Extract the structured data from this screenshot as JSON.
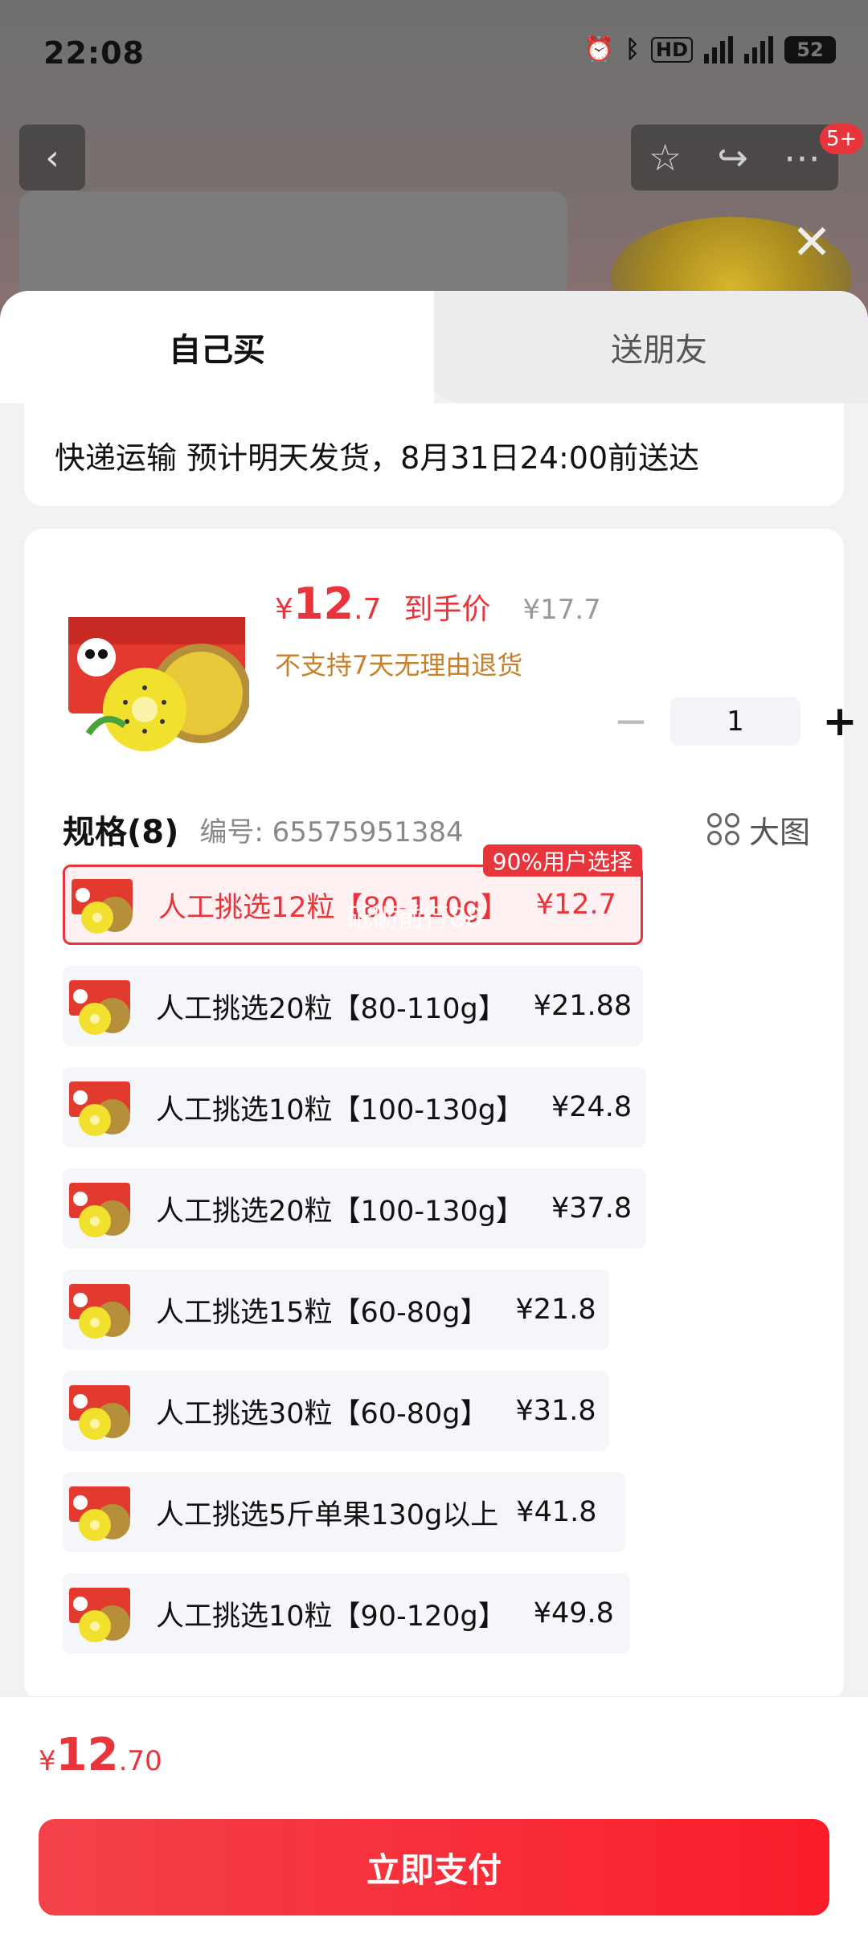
{
  "status_bar": {
    "time": "22:08",
    "battery": "52"
  },
  "top_bar": {
    "badge": "5+"
  },
  "tabs": {
    "self_buy": "自己买",
    "gift": "送朋友"
  },
  "shipping": {
    "text": "快递运输 预计明天发货，8月31日24:00前送达"
  },
  "product": {
    "price_currency": "¥",
    "price_integer": "12",
    "price_decimal": ".7",
    "price_label": "到手价",
    "original_price": "¥17.7",
    "return_policy": "不支持7天无理由退货",
    "quantity": "1"
  },
  "spec": {
    "title": "规格(8)",
    "code": "编号: 65575951384",
    "big_pic_label": "大图",
    "selected_tag": "90%用户选择",
    "watermark": "砥砺前行88",
    "items": [
      {
        "name": "人工挑选12粒【80-110g】",
        "price": "¥12.7",
        "selected": true
      },
      {
        "name": "人工挑选20粒【80-110g】",
        "price": "¥21.88"
      },
      {
        "name": "人工挑选10粒【100-130g】",
        "price": "¥24.8"
      },
      {
        "name": "人工挑选20粒【100-130g】",
        "price": "¥37.8"
      },
      {
        "name": "人工挑选15粒【60-80g】",
        "price": "¥21.8"
      },
      {
        "name": "人工挑选30粒【60-80g】",
        "price": "¥31.8"
      },
      {
        "name": "人工挑选5斤单果130g以上",
        "price": "¥41.8"
      },
      {
        "name": "人工挑选10粒【90-120g】",
        "price": "¥49.8"
      }
    ]
  },
  "footer": {
    "currency": "¥",
    "total_integer": "12",
    "total_decimal": ".70",
    "pay_label": "立即支付"
  },
  "colors": {
    "accent": "#e8353b",
    "warning": "#c8802a"
  }
}
